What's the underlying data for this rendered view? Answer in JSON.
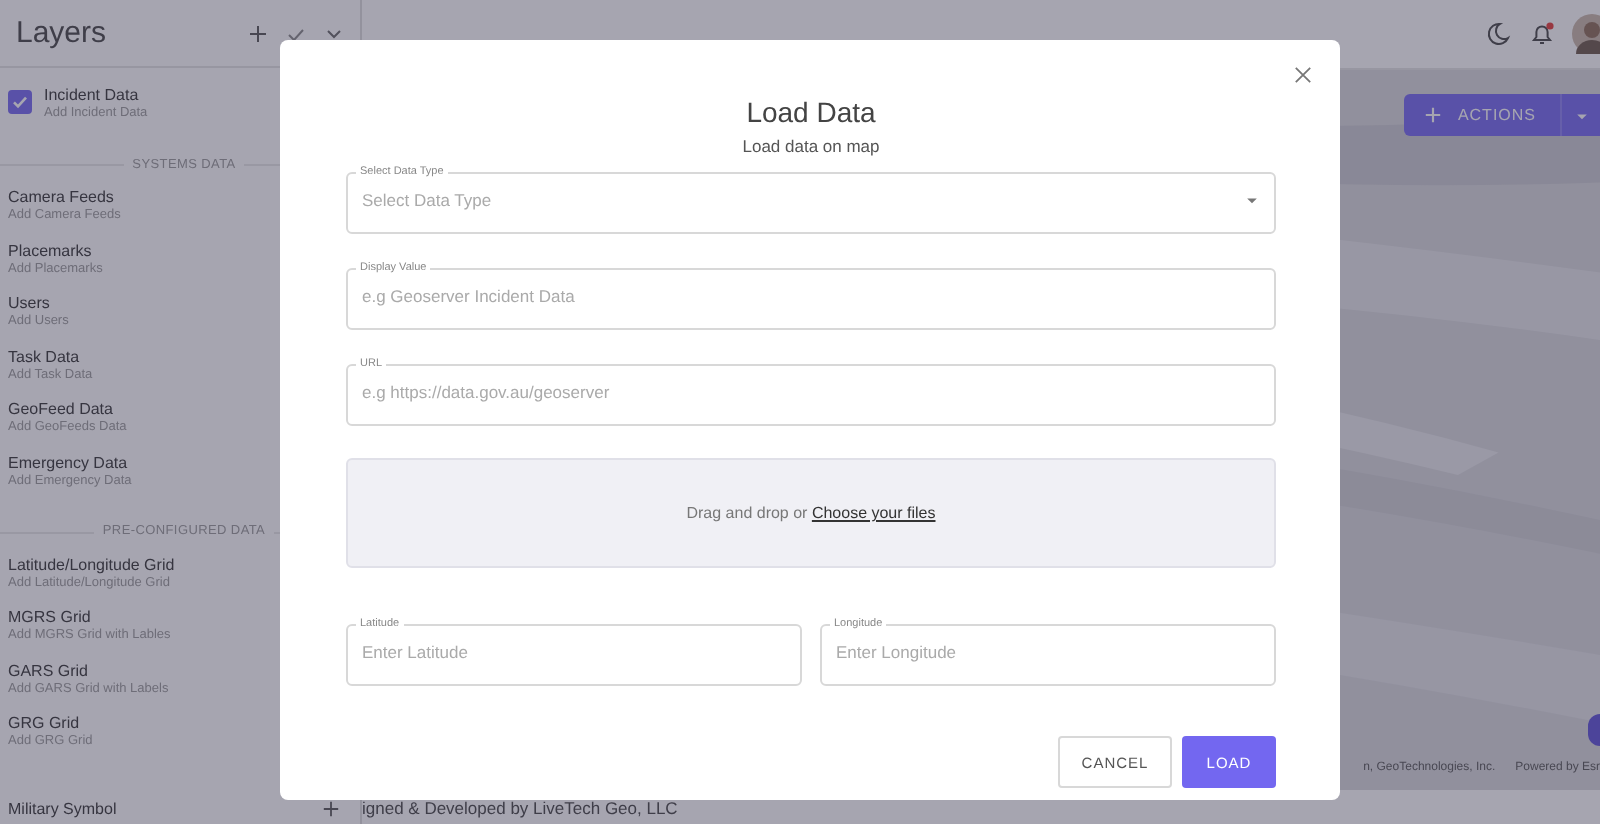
{
  "sidebar": {
    "title": "Layers",
    "entries": [
      {
        "kind": "checkbox",
        "title": "Incident Data",
        "subtitle": "Add Incident Data",
        "checked": true
      },
      {
        "kind": "divider",
        "label": "SYSTEMS DATA"
      },
      {
        "kind": "layer",
        "title": "Camera Feeds",
        "subtitle": "Add Camera Feeds"
      },
      {
        "kind": "layer",
        "title": "Placemarks",
        "subtitle": "Add Placemarks"
      },
      {
        "kind": "layer",
        "title": "Users",
        "subtitle": "Add Users"
      },
      {
        "kind": "layer",
        "title": "Task Data",
        "subtitle": "Add Task Data"
      },
      {
        "kind": "layer",
        "title": "GeoFeed Data",
        "subtitle": "Add GeoFeeds Data"
      },
      {
        "kind": "layer",
        "title": "Emergency Data",
        "subtitle": "Add Emergency Data"
      },
      {
        "kind": "divider",
        "label": "PRE-CONFIGURED DATA"
      },
      {
        "kind": "layer",
        "title": "Latitude/Longitude Grid",
        "subtitle": "Add Latitude/Longitude Grid"
      },
      {
        "kind": "layer",
        "title": "MGRS Grid",
        "subtitle": "Add MGRS Grid with Lables"
      },
      {
        "kind": "layer",
        "title": "GARS Grid",
        "subtitle": "Add GARS Grid with Labels"
      },
      {
        "kind": "layer",
        "title": "GRG Grid",
        "subtitle": "Add GRG Grid"
      },
      {
        "kind": "group",
        "title": "Military Symbol"
      }
    ]
  },
  "map": {
    "actions_button": "ACTIONS",
    "attribution": "n, GeoTechnologies, Inc.",
    "powered_by": "Powered by Esr",
    "footer": "igned & Developed by LiveTech Geo, LLC",
    "notification_unread": true
  },
  "dialog": {
    "title": "Load Data",
    "subtitle": "Load data on map",
    "fields": [
      {
        "kind": "select",
        "label": "Select Data Type",
        "placeholder": "Select Data Type"
      },
      {
        "kind": "text",
        "label": "Display Value",
        "placeholder": "e.g Geoserver Incident Data"
      },
      {
        "kind": "text",
        "label": "URL",
        "placeholder": "e.g https://data.gov.au/geoserver"
      }
    ],
    "dropzone": {
      "text": "Drag and drop or",
      "link": "Choose your files"
    },
    "coordinates": [
      {
        "label": "Latitude",
        "placeholder": "Enter Latitude"
      },
      {
        "label": "Longitude",
        "placeholder": "Enter Longitude"
      }
    ],
    "buttons": [
      {
        "label": "CANCEL",
        "kind": "secondary"
      },
      {
        "label": "LOAD",
        "kind": "primary"
      }
    ]
  }
}
